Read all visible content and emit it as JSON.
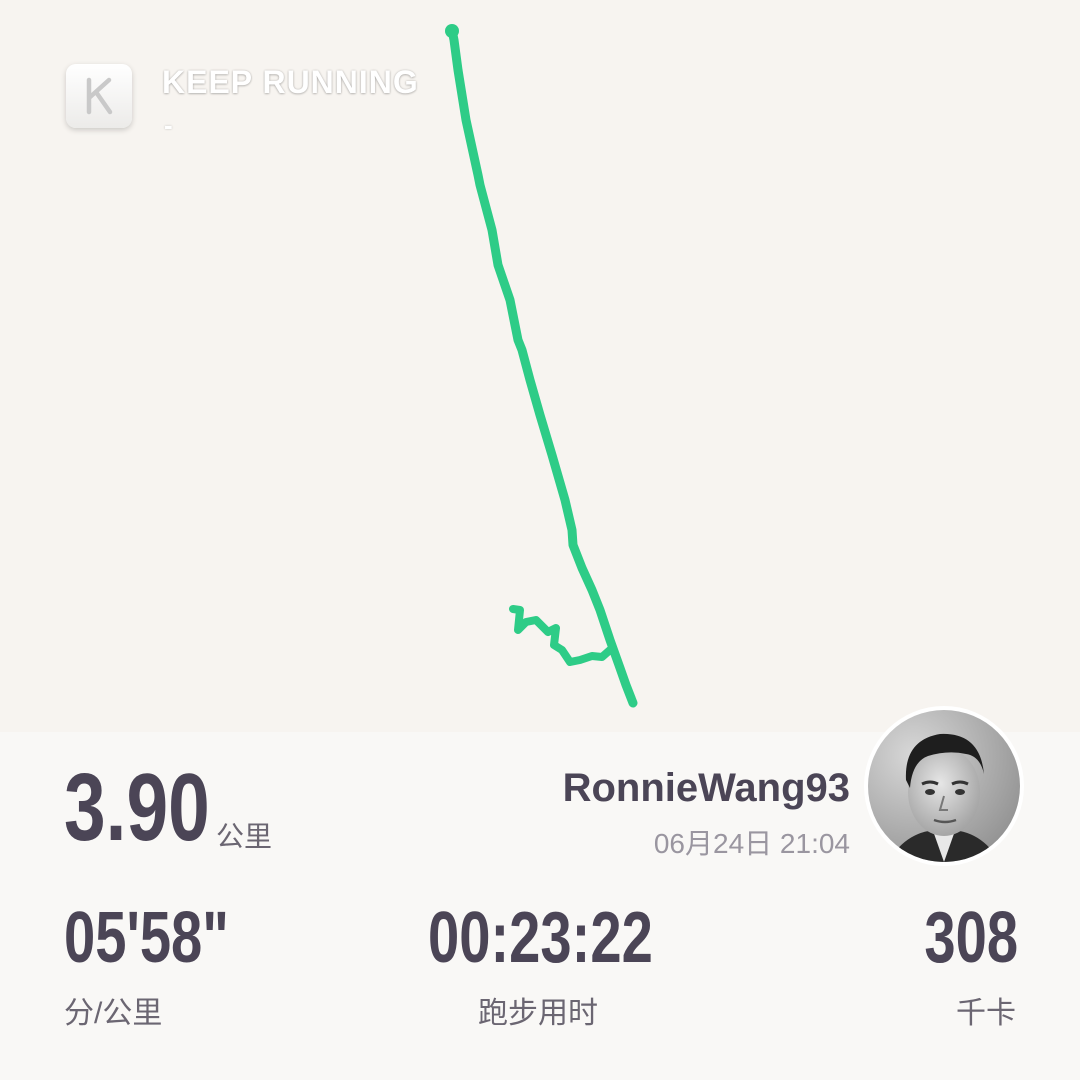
{
  "app": {
    "title": "KEEP RUNNING",
    "subtitle": "-",
    "logo_icon": "keep-k-logo-icon"
  },
  "map": {
    "route_color": "#2ecc87",
    "background_color": "#f7f4f0"
  },
  "summary": {
    "distance": "3.90",
    "distance_unit": "公里"
  },
  "user": {
    "name": "RonnieWang93",
    "timestamp": "06月24日 21:04",
    "avatar_icon": "user-avatar"
  },
  "stats": {
    "pace": {
      "value": "05'58\"",
      "label": "分/公里"
    },
    "duration": {
      "value": "00:23:22",
      "label": "跑步用时"
    },
    "calories": {
      "value": "308",
      "label": "千卡"
    }
  },
  "colors": {
    "text_primary": "#4b4556",
    "text_secondary": "#9a96a0",
    "panel_bg": "#f9f8f6"
  }
}
